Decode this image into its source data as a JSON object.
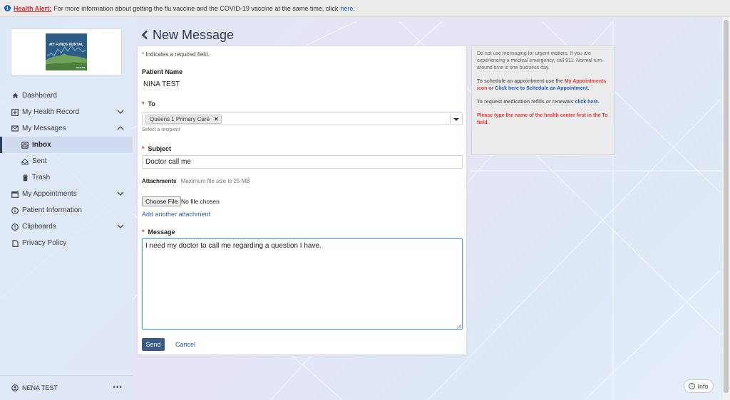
{
  "alert": {
    "label": "Health Alert:",
    "message": "For more information about getting the flu vaccine and the COVID-19 vaccine at the same time, click",
    "link": "here."
  },
  "logo": {
    "title": "MY FUNDS PORTAL",
    "subtitle": "HEALTH"
  },
  "sidebar": {
    "items": [
      {
        "label": "Dashboard",
        "icon": "home-icon"
      },
      {
        "label": "My Health Record",
        "icon": "plus-square-icon",
        "expandable": true
      },
      {
        "label": "My Messages",
        "icon": "envelope-icon",
        "expanded": true
      },
      {
        "label": "Inbox",
        "icon": "inbox-icon",
        "active": true
      },
      {
        "label": "Sent",
        "icon": "sent-icon"
      },
      {
        "label": "Trash",
        "icon": "trash-icon"
      },
      {
        "label": "My Appointments",
        "icon": "calendar-icon",
        "expandable": true
      },
      {
        "label": "Patient Information",
        "icon": "info-circle-icon"
      },
      {
        "label": "Clipboards",
        "icon": "clipboard-icon",
        "expandable": true
      },
      {
        "label": "Privacy Policy",
        "icon": "document-icon"
      }
    ],
    "user": "NENA TEST"
  },
  "header": {
    "title": "New Message"
  },
  "form": {
    "required_note": "Indicates a required field.",
    "patient_name_label": "Patient Name",
    "patient_name": "NINA TEST",
    "to_label": "To",
    "to_chip": "Queens 1 Primary Care",
    "to_help": "Select a recipient",
    "subject_label": "Subject",
    "subject_value": "Doctor call me",
    "attachments_label": "Attachments",
    "attachments_note": "Maximum file size is 25 MB",
    "choose_file": "Choose File",
    "no_file": "No file chosen",
    "add_attachment": "Add another attachment",
    "message_label": "Message",
    "message_value": "I need my doctor to call me regarding a question I have.",
    "send": "Send",
    "cancel": "Cancel"
  },
  "info_panel": {
    "p1": "Do not use messaging for urgent matters. If you are experiencing a medical emergency, call 911. Normal turn-around time is one business day.",
    "p2_a": "To schedule an appointment use the",
    "p2_link1": "My Appointments icon",
    "p2_b": "or",
    "p2_link2": "Click here to Schedule an Appointment.",
    "p3_a": "To request medication refills or renewals",
    "p3_link": "click here.",
    "p4": "Please type the name of the health center first in the To field."
  },
  "info_button": "Info",
  "colors": {
    "accent": "#3a5a86",
    "alert": "#d32f2f",
    "link": "#1e5bb5"
  }
}
